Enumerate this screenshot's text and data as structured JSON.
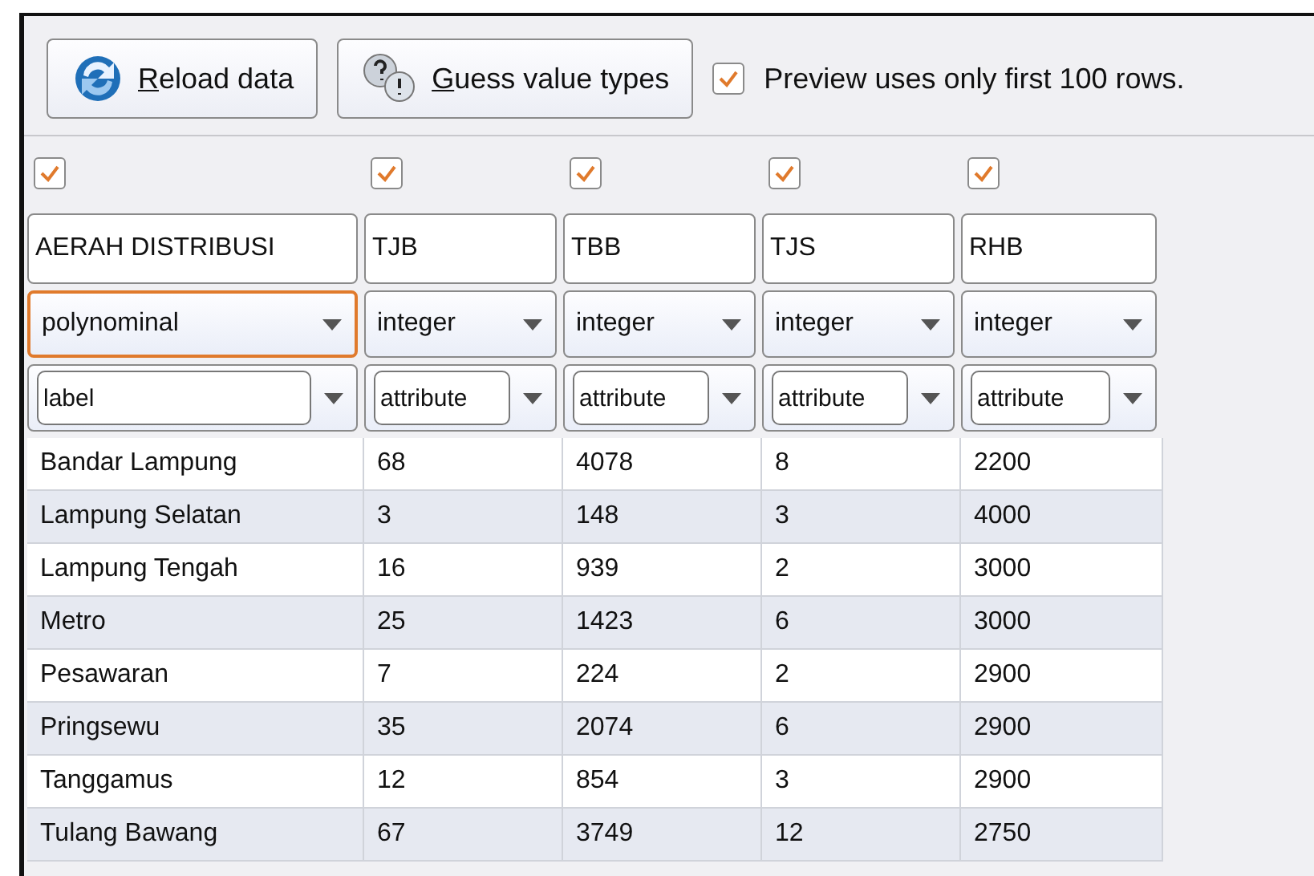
{
  "toolbar": {
    "buttons": [
      {
        "kind": "reload",
        "label": "Reload data",
        "mnemonic_underlined": true
      },
      {
        "kind": "guess",
        "label": "Guess value types",
        "mnemonic_underlined": true
      }
    ],
    "preview_checkbox": {
      "label": "Preview uses only first 100 rows.",
      "checked": true
    }
  },
  "columns": [
    {
      "included": true,
      "name": "AERAH DISTRIBUSI",
      "type": "polynominal",
      "type_focused": true,
      "role": "label"
    },
    {
      "included": true,
      "name": "TJB",
      "type": "integer",
      "type_focused": false,
      "role": "attribute"
    },
    {
      "included": true,
      "name": "TBB",
      "type": "integer",
      "type_focused": false,
      "role": "attribute"
    },
    {
      "included": true,
      "name": "TJS",
      "type": "integer",
      "type_focused": false,
      "role": "attribute"
    },
    {
      "included": true,
      "name": "RHB",
      "type": "integer",
      "type_focused": false,
      "role": "attribute"
    }
  ],
  "rows": [
    [
      "Bandar Lampung",
      "68",
      "4078",
      "8",
      "2200"
    ],
    [
      "Lampung Selatan",
      "3",
      "148",
      "3",
      "4000"
    ],
    [
      "Lampung Tengah",
      "16",
      "939",
      "2",
      "3000"
    ],
    [
      "Metro",
      "25",
      "1423",
      "6",
      "3000"
    ],
    [
      "Pesawaran",
      "7",
      "224",
      "2",
      "2900"
    ],
    [
      "Pringsewu",
      "35",
      "2074",
      "6",
      "2900"
    ],
    [
      "Tanggamus",
      "12",
      "854",
      "3",
      "2900"
    ],
    [
      "Tulang Bawang",
      "67",
      "3749",
      "12",
      "2750"
    ]
  ]
}
